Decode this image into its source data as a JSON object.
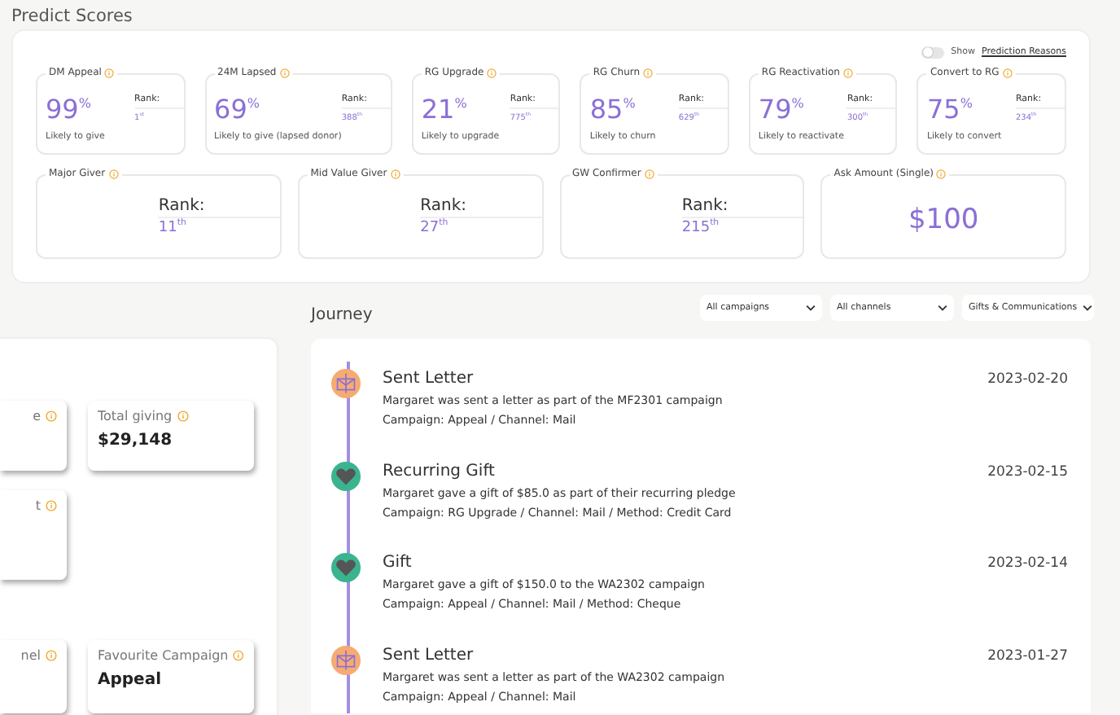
{
  "predict_scores": {
    "title": "Predict Scores",
    "toggle": {
      "prefix": "Show",
      "link": "Prediction Reasons",
      "on": false
    },
    "scores": [
      {
        "label": "DM Appeal",
        "value": "99$^{%}$",
        "rank_label": "Rank:",
        "rank": "1$^{st}$",
        "caption": "Likely to give"
      },
      {
        "label": "24M Lapsed",
        "value": "69$^{%}$",
        "rank_label": "Rank:",
        "rank": "388$^{th}$",
        "caption": "Likely to give (lapsed donor)"
      },
      {
        "label": "RG Upgrade",
        "value": "21$^{%}$",
        "rank_label": "Rank:",
        "rank": "775$^{th}$",
        "caption": "Likely to upgrade"
      },
      {
        "label": "RG Churn",
        "value": "85$^{%}$",
        "rank_label": "Rank:",
        "rank": "629$^{th}$",
        "caption": "Likely to churn"
      },
      {
        "label": "RG Reactivation",
        "value": "79$^{%}$",
        "rank_label": "Rank:",
        "rank": "300$^{th}$",
        "caption": "Likely to reactivate"
      },
      {
        "label": "Convert to RG",
        "value": "75$^{%}$",
        "rank_label": "Rank:",
        "rank": "234$^{th}$",
        "caption": "Likely to convert"
      }
    ],
    "segments": [
      {
        "kind": "rank",
        "label": "Major Giver",
        "rank_label": "Rank:",
        "rank": "11$^{th}$"
      },
      {
        "kind": "rank",
        "label": "Mid Value Giver",
        "rank_label": "Rank:",
        "rank": "27$^{th}$"
      },
      {
        "kind": "rank",
        "label": "GW Confirmer",
        "rank_label": "Rank:",
        "rank": "215$^{th}$"
      },
      {
        "kind": "amount",
        "label": "Ask Amount (Single)",
        "value": "$100"
      }
    ]
  },
  "summary": {
    "cards": [
      {
        "label": "e"
      },
      {
        "label": "Total giving",
        "value": "$29,148"
      },
      {
        "label": "t"
      },
      {
        "label": "nel"
      },
      {
        "label": "Favourite Campaign",
        "value": "Appeal"
      }
    ]
  },
  "journey": {
    "title": "Journey",
    "filters": [
      "All campaigns",
      "All channels",
      "Gifts & Communications"
    ],
    "events": [
      {
        "kind": "letter",
        "title": "Sent Letter",
        "date": "2023-02-20",
        "description": "Margaret was sent a letter as part of the MF2301 campaign",
        "details": "Campaign: Appeal / Channel: Mail"
      },
      {
        "kind": "gift",
        "title": "Recurring Gift",
        "date": "2023-02-15",
        "description": "Margaret gave a gift of $85.0 as part of their recurring pledge",
        "details": "Campaign: RG Upgrade / Channel: Mail / Method: Credit Card"
      },
      {
        "kind": "gift",
        "title": "Gift",
        "date": "2023-02-14",
        "description": "Margaret gave a gift of $150.0 to the WA2302 campaign",
        "details": "Campaign: Appeal / Channel: Mail / Method: Cheque"
      },
      {
        "kind": "letter",
        "title": "Sent Letter",
        "date": "2023-01-27",
        "description": "Margaret was sent a letter as part of the WA2302 campaign",
        "details": "Campaign: Appeal / Channel: Mail"
      }
    ]
  }
}
